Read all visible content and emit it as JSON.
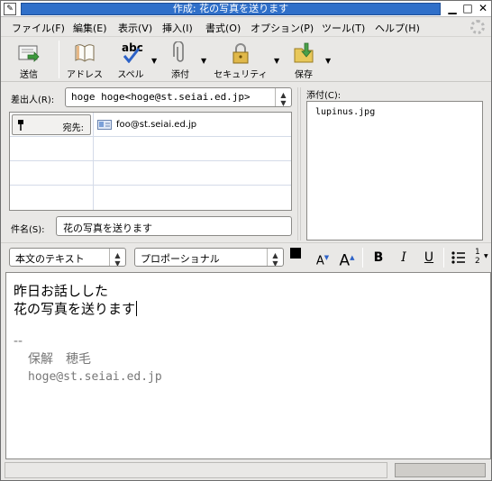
{
  "window": {
    "title": "作成: 花の写真を送ります",
    "app_icon": "compose-icon",
    "controls": [
      "minimize-icon",
      "maximize-icon",
      "close-icon"
    ]
  },
  "menubar": {
    "items": [
      {
        "label": "ファイル(F)"
      },
      {
        "label": "編集(E)"
      },
      {
        "label": "表示(V)"
      },
      {
        "label": "挿入(I)"
      },
      {
        "label": "書式(O)"
      },
      {
        "label": "オプション(P)"
      },
      {
        "label": "ツール(T)"
      },
      {
        "label": "ヘルプ(H)"
      }
    ]
  },
  "toolbar": {
    "send": {
      "label": "送信",
      "icon": "send-icon"
    },
    "address": {
      "label": "アドレス",
      "icon": "address-book-icon"
    },
    "spell": {
      "label": "スペル",
      "icon": "spellcheck-icon",
      "icon_text": "abc"
    },
    "attach": {
      "label": "添付",
      "icon": "paperclip-icon"
    },
    "security": {
      "label": "セキュリティ",
      "icon": "lock-icon"
    },
    "save": {
      "label": "保存",
      "icon": "save-icon"
    }
  },
  "compose": {
    "from_label": "差出人(R):",
    "from_value": "hoge hoge<hoge@st.seiai.ed.jp>",
    "recipients": [
      {
        "type": "宛先:",
        "address": "foo@st.seiai.ed.jp"
      }
    ],
    "subject_label": "件名(S):",
    "subject_value": "花の写真を送ります",
    "attach_label": "添付(C):",
    "attachments": [
      "lupinus.jpg"
    ]
  },
  "format": {
    "paragraph_style": "本文のテキスト",
    "font": "プロポーショナル",
    "bold": "B",
    "italic": "I",
    "underline": "U",
    "text_color": "#000000"
  },
  "body": {
    "lines": [
      "昨日お話しした",
      "花の写真を送ります"
    ],
    "signature": [
      "--",
      "保解　穂毛",
      "hoge@st.seiai.ed.jp"
    ]
  },
  "colors": {
    "title_strip": "#2f6fc9",
    "signature_text": "#777777"
  }
}
